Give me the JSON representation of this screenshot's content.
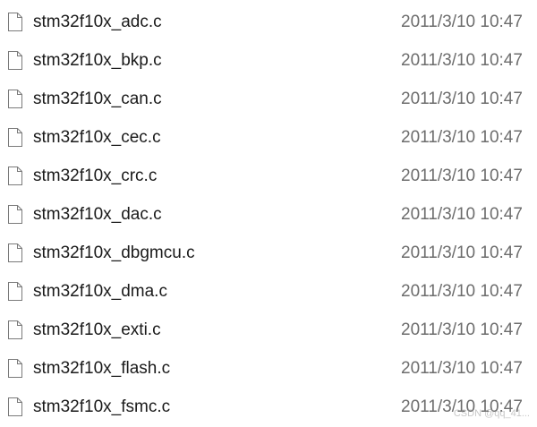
{
  "files": [
    {
      "name": "stm32f10x_adc.c",
      "modified": "2011/3/10 10:47",
      "icon": "document-icon"
    },
    {
      "name": "stm32f10x_bkp.c",
      "modified": "2011/3/10 10:47",
      "icon": "document-icon"
    },
    {
      "name": "stm32f10x_can.c",
      "modified": "2011/3/10 10:47",
      "icon": "document-icon"
    },
    {
      "name": "stm32f10x_cec.c",
      "modified": "2011/3/10 10:47",
      "icon": "document-icon"
    },
    {
      "name": "stm32f10x_crc.c",
      "modified": "2011/3/10 10:47",
      "icon": "document-icon"
    },
    {
      "name": "stm32f10x_dac.c",
      "modified": "2011/3/10 10:47",
      "icon": "document-icon"
    },
    {
      "name": "stm32f10x_dbgmcu.c",
      "modified": "2011/3/10 10:47",
      "icon": "document-icon"
    },
    {
      "name": "stm32f10x_dma.c",
      "modified": "2011/3/10 10:47",
      "icon": "document-icon"
    },
    {
      "name": "stm32f10x_exti.c",
      "modified": "2011/3/10 10:47",
      "icon": "document-icon"
    },
    {
      "name": "stm32f10x_flash.c",
      "modified": "2011/3/10 10:47",
      "icon": "document-icon"
    },
    {
      "name": "stm32f10x_fsmc.c",
      "modified": "2011/3/10 10:47",
      "icon": "document-icon"
    }
  ],
  "watermark": "CSDN @qq_41..."
}
